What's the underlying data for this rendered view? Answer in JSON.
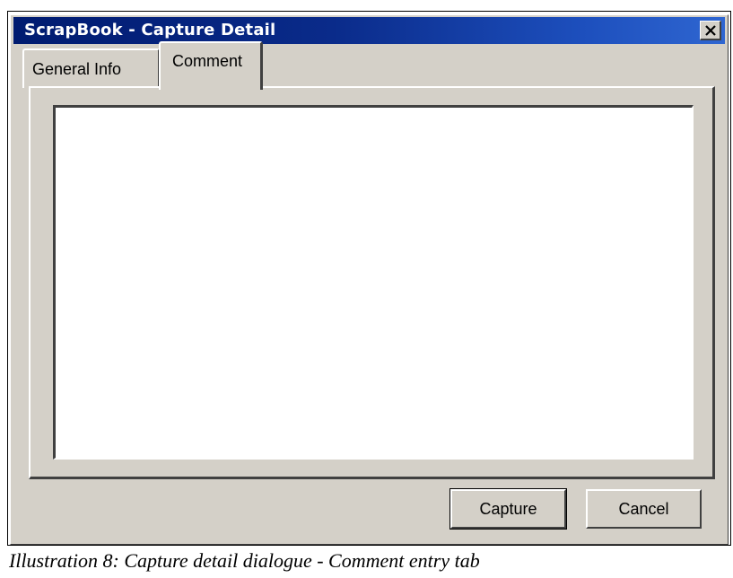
{
  "window": {
    "title": "ScrapBook - Capture Detail",
    "close_icon": "close-x-icon"
  },
  "tabs": [
    {
      "label": "General Info",
      "selected": false
    },
    {
      "label": "Comment",
      "selected": true
    }
  ],
  "comment": {
    "value": ""
  },
  "buttons": {
    "capture_label": "Capture",
    "cancel_label": "Cancel"
  },
  "caption": "Illustration 8: Capture detail dialogue - Comment entry tab",
  "colors": {
    "titlebar_start": "#001b70",
    "titlebar_end": "#2f66d1",
    "dialog_face": "#d4d0c8"
  }
}
